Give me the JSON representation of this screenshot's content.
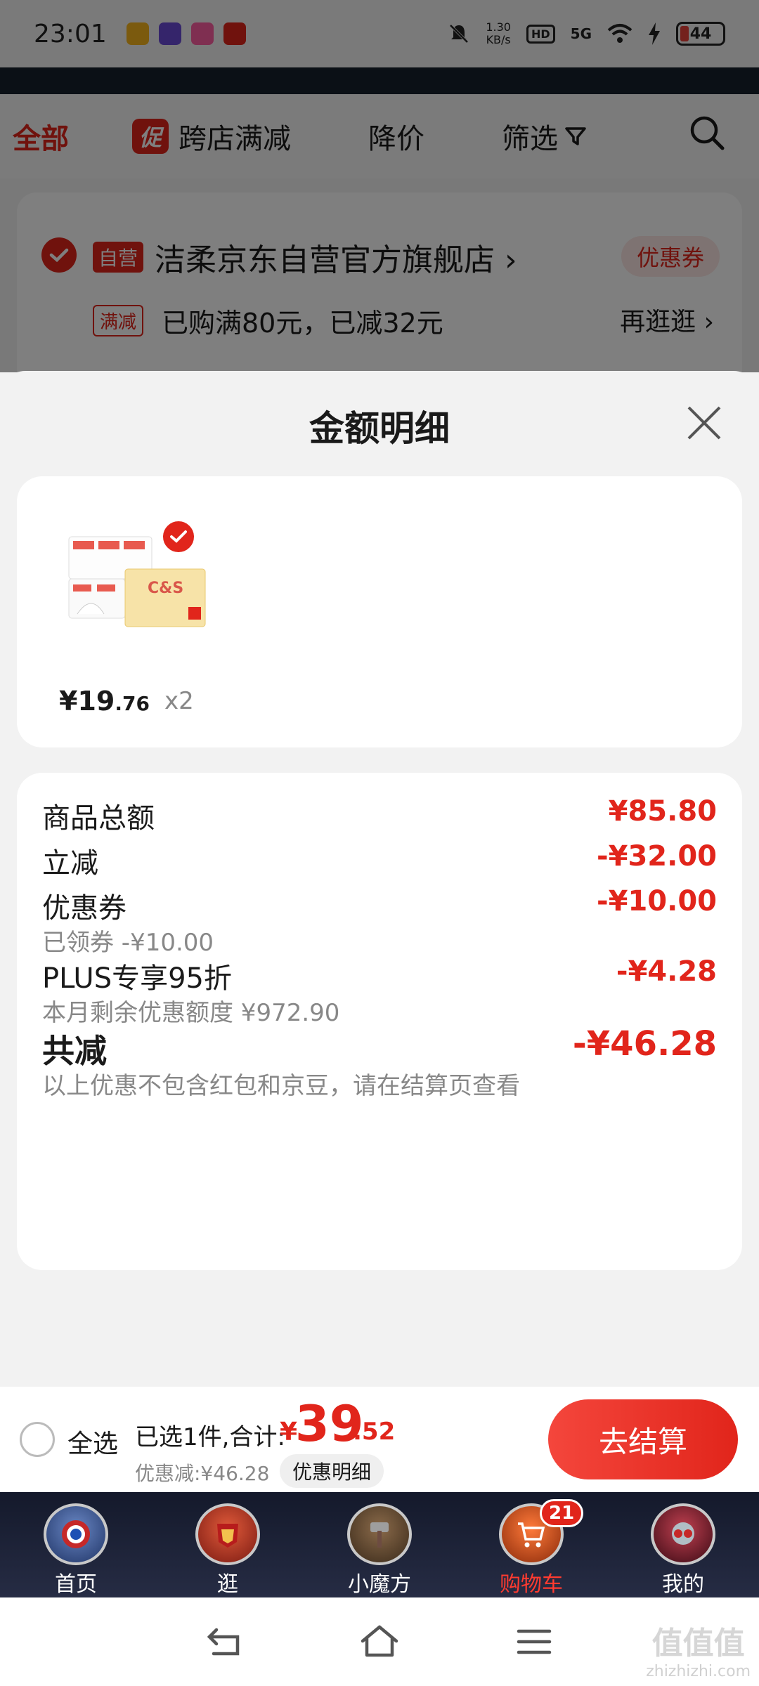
{
  "status_bar": {
    "time": "23:01",
    "net_speed_value": "1.30",
    "net_speed_unit": "KB/s",
    "hd": "HD",
    "network": "5G",
    "battery": "44"
  },
  "filter_bar": {
    "all": "全部",
    "promo_badge": "促",
    "cross_store": "跨店满减",
    "price_drop": "降价",
    "filter": "筛选"
  },
  "store": {
    "self_badge": "自营",
    "name": "洁柔京东自营官方旗舰店",
    "coupon": "优惠券",
    "full_badge": "满减",
    "full_text": "已购满80元，已减32元",
    "shop_more": "再逛逛"
  },
  "sheet": {
    "title": "金额明细",
    "product": {
      "price_int": "¥19",
      "price_dec": ".76",
      "qty": "x2"
    },
    "rows": [
      {
        "label": "商品总额",
        "value": "¥85.80"
      },
      {
        "label": "立减",
        "value": "-¥32.00"
      },
      {
        "label": "优惠券",
        "sub": "已领券 -¥10.00",
        "value": "-¥10.00"
      },
      {
        "label": "PLUS专享95折",
        "sub": "本月剩余优惠额度 ¥972.90",
        "value": "-¥4.28"
      },
      {
        "label": "共减",
        "sub": "以上优惠不包含红包和京豆，请在结算页查看",
        "value": "-¥46.28"
      }
    ]
  },
  "checkout": {
    "select_all": "全选",
    "selected_text": "已选1件,合计:",
    "total_yen": "¥",
    "total_int": "39",
    "total_dec": ".52",
    "discount_text": "优惠减:¥46.28",
    "detail_pill": "优惠明细",
    "button": "去结算"
  },
  "tabs": [
    {
      "label": "首页"
    },
    {
      "label": "逛"
    },
    {
      "label": "小魔方"
    },
    {
      "label": "购物车",
      "badge": "21"
    },
    {
      "label": "我的"
    }
  ],
  "watermark": {
    "big": "值值值",
    "small": "zhizhizhi.com"
  },
  "colors": {
    "accent": "#e1251b",
    "sheet_bg": "#f2f2f2",
    "tabbar_bg": "#1b2136"
  }
}
